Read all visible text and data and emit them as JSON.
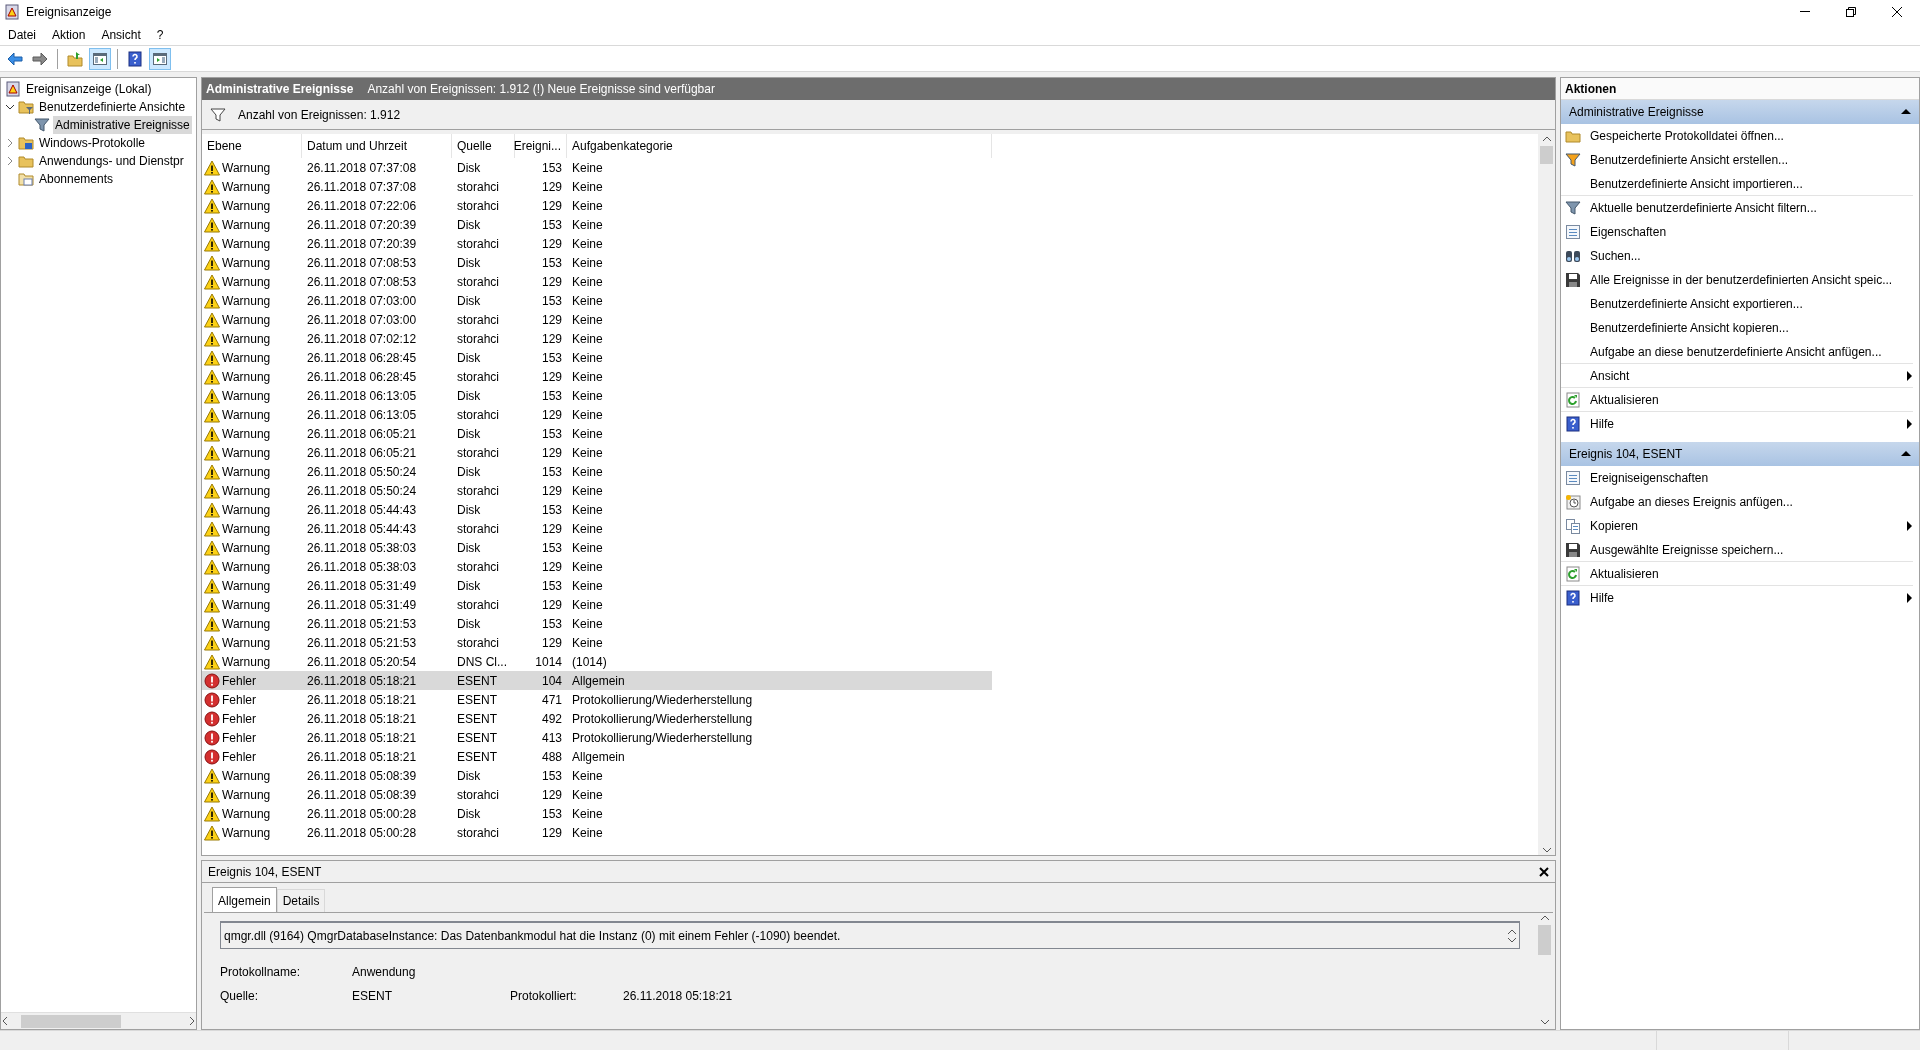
{
  "window": {
    "title": "Ereignisanzeige"
  },
  "menu": [
    "Datei",
    "Aktion",
    "Ansicht",
    "?"
  ],
  "toolbar": [
    {
      "kind": "back",
      "pressed": false
    },
    {
      "kind": "forward",
      "pressed": false
    },
    {
      "kind": "separator"
    },
    {
      "kind": "folder-up",
      "pressed": false
    },
    {
      "kind": "pane-left",
      "pressed": true
    },
    {
      "kind": "separator"
    },
    {
      "kind": "help",
      "pressed": false
    },
    {
      "kind": "pane-right",
      "pressed": true
    }
  ],
  "tree": [
    {
      "label": "Ereignisanzeige (Lokal)",
      "kind": "viewer",
      "selected": false,
      "children": [
        {
          "label": "Benutzerdefinierte Ansichte",
          "kind": "folder-filter",
          "selected": false,
          "expanded": true,
          "children": [
            {
              "label": "Administrative Ereignisse",
              "kind": "filter",
              "selected": true
            }
          ]
        },
        {
          "label": "Windows-Protokolle",
          "kind": "folder-win",
          "selected": false,
          "expanded": false
        },
        {
          "label": "Anwendungs- und Dienstpr",
          "kind": "folder",
          "selected": false,
          "expanded": false
        },
        {
          "label": "Abonnements",
          "kind": "folder-sub",
          "selected": false
        }
      ]
    }
  ],
  "view": {
    "title": "Administrative Ereignisse",
    "notice": "Anzahl von Ereignissen: 1.912 (!) Neue Ereignisse sind verfügbar",
    "filter_text": "Anzahl von Ereignissen: 1.912"
  },
  "table": {
    "columns": [
      "Ebene",
      "Datum und Uhrzeit",
      "Quelle",
      "Ereigni...",
      "Aufgabenkategorie"
    ],
    "rows": [
      {
        "kind": "warning",
        "level": "Warnung",
        "date": "26.11.2018 07:37:08",
        "source": "Disk",
        "id": "153",
        "category": "Keine",
        "selected": false
      },
      {
        "kind": "warning",
        "level": "Warnung",
        "date": "26.11.2018 07:37:08",
        "source": "storahci",
        "id": "129",
        "category": "Keine",
        "selected": false
      },
      {
        "kind": "warning",
        "level": "Warnung",
        "date": "26.11.2018 07:22:06",
        "source": "storahci",
        "id": "129",
        "category": "Keine",
        "selected": false
      },
      {
        "kind": "warning",
        "level": "Warnung",
        "date": "26.11.2018 07:20:39",
        "source": "Disk",
        "id": "153",
        "category": "Keine",
        "selected": false
      },
      {
        "kind": "warning",
        "level": "Warnung",
        "date": "26.11.2018 07:20:39",
        "source": "storahci",
        "id": "129",
        "category": "Keine",
        "selected": false
      },
      {
        "kind": "warning",
        "level": "Warnung",
        "date": "26.11.2018 07:08:53",
        "source": "Disk",
        "id": "153",
        "category": "Keine",
        "selected": false
      },
      {
        "kind": "warning",
        "level": "Warnung",
        "date": "26.11.2018 07:08:53",
        "source": "storahci",
        "id": "129",
        "category": "Keine",
        "selected": false
      },
      {
        "kind": "warning",
        "level": "Warnung",
        "date": "26.11.2018 07:03:00",
        "source": "Disk",
        "id": "153",
        "category": "Keine",
        "selected": false
      },
      {
        "kind": "warning",
        "level": "Warnung",
        "date": "26.11.2018 07:03:00",
        "source": "storahci",
        "id": "129",
        "category": "Keine",
        "selected": false
      },
      {
        "kind": "warning",
        "level": "Warnung",
        "date": "26.11.2018 07:02:12",
        "source": "storahci",
        "id": "129",
        "category": "Keine",
        "selected": false
      },
      {
        "kind": "warning",
        "level": "Warnung",
        "date": "26.11.2018 06:28:45",
        "source": "Disk",
        "id": "153",
        "category": "Keine",
        "selected": false
      },
      {
        "kind": "warning",
        "level": "Warnung",
        "date": "26.11.2018 06:28:45",
        "source": "storahci",
        "id": "129",
        "category": "Keine",
        "selected": false
      },
      {
        "kind": "warning",
        "level": "Warnung",
        "date": "26.11.2018 06:13:05",
        "source": "Disk",
        "id": "153",
        "category": "Keine",
        "selected": false
      },
      {
        "kind": "warning",
        "level": "Warnung",
        "date": "26.11.2018 06:13:05",
        "source": "storahci",
        "id": "129",
        "category": "Keine",
        "selected": false
      },
      {
        "kind": "warning",
        "level": "Warnung",
        "date": "26.11.2018 06:05:21",
        "source": "Disk",
        "id": "153",
        "category": "Keine",
        "selected": false
      },
      {
        "kind": "warning",
        "level": "Warnung",
        "date": "26.11.2018 06:05:21",
        "source": "storahci",
        "id": "129",
        "category": "Keine",
        "selected": false
      },
      {
        "kind": "warning",
        "level": "Warnung",
        "date": "26.11.2018 05:50:24",
        "source": "Disk",
        "id": "153",
        "category": "Keine",
        "selected": false
      },
      {
        "kind": "warning",
        "level": "Warnung",
        "date": "26.11.2018 05:50:24",
        "source": "storahci",
        "id": "129",
        "category": "Keine",
        "selected": false
      },
      {
        "kind": "warning",
        "level": "Warnung",
        "date": "26.11.2018 05:44:43",
        "source": "Disk",
        "id": "153",
        "category": "Keine",
        "selected": false
      },
      {
        "kind": "warning",
        "level": "Warnung",
        "date": "26.11.2018 05:44:43",
        "source": "storahci",
        "id": "129",
        "category": "Keine",
        "selected": false
      },
      {
        "kind": "warning",
        "level": "Warnung",
        "date": "26.11.2018 05:38:03",
        "source": "Disk",
        "id": "153",
        "category": "Keine",
        "selected": false
      },
      {
        "kind": "warning",
        "level": "Warnung",
        "date": "26.11.2018 05:38:03",
        "source": "storahci",
        "id": "129",
        "category": "Keine",
        "selected": false
      },
      {
        "kind": "warning",
        "level": "Warnung",
        "date": "26.11.2018 05:31:49",
        "source": "Disk",
        "id": "153",
        "category": "Keine",
        "selected": false
      },
      {
        "kind": "warning",
        "level": "Warnung",
        "date": "26.11.2018 05:31:49",
        "source": "storahci",
        "id": "129",
        "category": "Keine",
        "selected": false
      },
      {
        "kind": "warning",
        "level": "Warnung",
        "date": "26.11.2018 05:21:53",
        "source": "Disk",
        "id": "153",
        "category": "Keine",
        "selected": false
      },
      {
        "kind": "warning",
        "level": "Warnung",
        "date": "26.11.2018 05:21:53",
        "source": "storahci",
        "id": "129",
        "category": "Keine",
        "selected": false
      },
      {
        "kind": "warning",
        "level": "Warnung",
        "date": "26.11.2018 05:20:54",
        "source": "DNS Cl...",
        "id": "1014",
        "category": "(1014)",
        "selected": false
      },
      {
        "kind": "error",
        "level": "Fehler",
        "date": "26.11.2018 05:18:21",
        "source": "ESENT",
        "id": "104",
        "category": "Allgemein",
        "selected": true
      },
      {
        "kind": "error",
        "level": "Fehler",
        "date": "26.11.2018 05:18:21",
        "source": "ESENT",
        "id": "471",
        "category": "Protokollierung/Wiederherstellung",
        "selected": false
      },
      {
        "kind": "error",
        "level": "Fehler",
        "date": "26.11.2018 05:18:21",
        "source": "ESENT",
        "id": "492",
        "category": "Protokollierung/Wiederherstellung",
        "selected": false
      },
      {
        "kind": "error",
        "level": "Fehler",
        "date": "26.11.2018 05:18:21",
        "source": "ESENT",
        "id": "413",
        "category": "Protokollierung/Wiederherstellung",
        "selected": false
      },
      {
        "kind": "error",
        "level": "Fehler",
        "date": "26.11.2018 05:18:21",
        "source": "ESENT",
        "id": "488",
        "category": "Allgemein",
        "selected": false
      },
      {
        "kind": "warning",
        "level": "Warnung",
        "date": "26.11.2018 05:08:39",
        "source": "Disk",
        "id": "153",
        "category": "Keine",
        "selected": false
      },
      {
        "kind": "warning",
        "level": "Warnung",
        "date": "26.11.2018 05:08:39",
        "source": "storahci",
        "id": "129",
        "category": "Keine",
        "selected": false
      },
      {
        "kind": "warning",
        "level": "Warnung",
        "date": "26.11.2018 05:00:28",
        "source": "Disk",
        "id": "153",
        "category": "Keine",
        "selected": false
      },
      {
        "kind": "warning",
        "level": "Warnung",
        "date": "26.11.2018 05:00:28",
        "source": "storahci",
        "id": "129",
        "category": "Keine",
        "selected": false
      }
    ]
  },
  "details": {
    "title": "Ereignis 104, ESENT",
    "tabs": [
      {
        "label": "Allgemein",
        "selected": true
      },
      {
        "label": "Details",
        "selected": false
      }
    ],
    "message": "qmgr.dll (9164) QmgrDatabaseInstance: Das Datenbankmodul hat die Instanz (0) mit einem Fehler (-1090) beendet.",
    "fields": [
      {
        "label": "Protokollname:",
        "value": "Anwendung"
      },
      {
        "label": "Quelle:",
        "value": "ESENT",
        "label2": "Protokolliert:",
        "value2": "26.11.2018 05:18:21"
      }
    ]
  },
  "actions": {
    "title": "Aktionen",
    "sections": [
      {
        "title": "Administrative Ereignisse",
        "expanded": true,
        "items": [
          {
            "label": "Gespeicherte Protokolldatei öffnen...",
            "kind": "folder",
            "submenu": false,
            "separator": false
          },
          {
            "label": "Benutzerdefinierte Ansicht erstellen...",
            "kind": "filter-new",
            "submenu": false,
            "separator": false
          },
          {
            "label": "Benutzerdefinierte Ansicht importieren...",
            "kind": "none",
            "submenu": false,
            "separator": true
          },
          {
            "label": "Aktuelle benutzerdefinierte Ansicht filtern...",
            "kind": "filter",
            "submenu": false,
            "separator": false
          },
          {
            "label": "Eigenschaften",
            "kind": "properties",
            "submenu": false,
            "separator": false
          },
          {
            "label": "Suchen...",
            "kind": "binoculars",
            "submenu": false,
            "separator": false
          },
          {
            "label": "Alle Ereignisse in der benutzerdefinierten Ansicht speic...",
            "kind": "save",
            "submenu": false,
            "separator": false
          },
          {
            "label": "Benutzerdefinierte Ansicht exportieren...",
            "kind": "none",
            "submenu": false,
            "separator": false
          },
          {
            "label": "Benutzerdefinierte Ansicht kopieren...",
            "kind": "none",
            "submenu": false,
            "separator": false
          },
          {
            "label": "Aufgabe an diese benutzerdefinierte Ansicht anfügen...",
            "kind": "none",
            "submenu": false,
            "separator": true
          },
          {
            "label": "Ansicht",
            "kind": "none",
            "submenu": true,
            "separator": true
          },
          {
            "label": "Aktualisieren",
            "kind": "refresh",
            "submenu": false,
            "separator": true
          },
          {
            "label": "Hilfe",
            "kind": "help",
            "submenu": true,
            "separator": false
          }
        ]
      },
      {
        "title": "Ereignis 104, ESENT",
        "expanded": true,
        "items": [
          {
            "label": "Ereigniseigenschaften",
            "kind": "properties",
            "submenu": false,
            "separator": false
          },
          {
            "label": "Aufgabe an dieses Ereignis anfügen...",
            "kind": "task",
            "submenu": false,
            "separator": false
          },
          {
            "label": "Kopieren",
            "kind": "copy",
            "submenu": true,
            "separator": false
          },
          {
            "label": "Ausgewählte Ereignisse speichern...",
            "kind": "save",
            "submenu": false,
            "separator": true
          },
          {
            "label": "Aktualisieren",
            "kind": "refresh",
            "submenu": false,
            "separator": true
          },
          {
            "label": "Hilfe",
            "kind": "help",
            "submenu": true,
            "separator": false
          }
        ]
      }
    ]
  }
}
